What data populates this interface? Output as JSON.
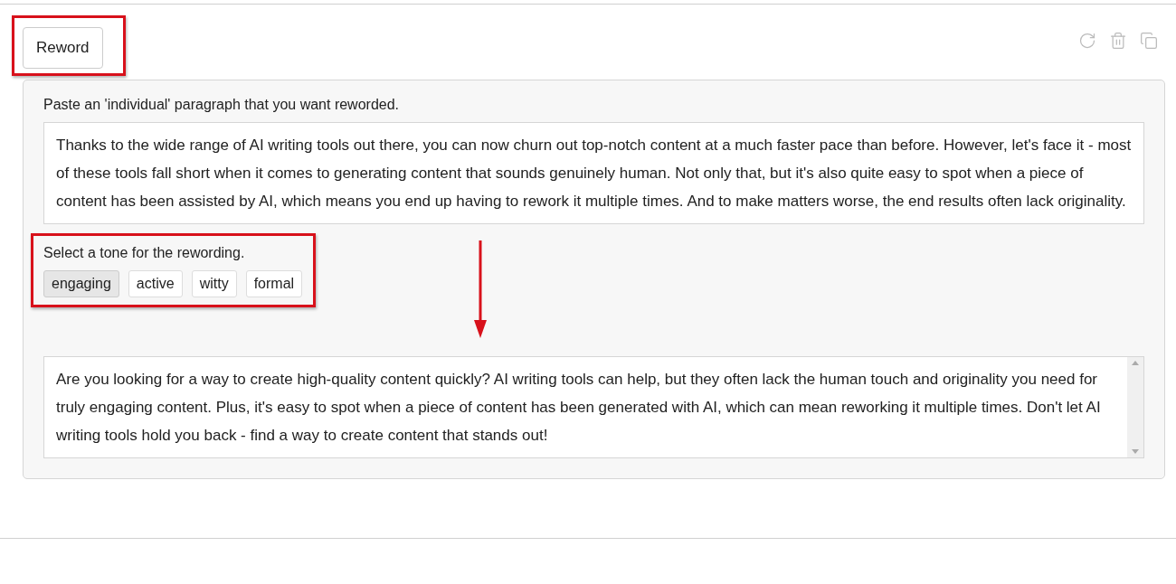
{
  "action_button": {
    "label": "Reword"
  },
  "input": {
    "label": "Paste an 'individual' paragraph that you want reworded.",
    "value": "Thanks to the wide range of AI writing tools out there, you can now churn out top-notch content at a much faster pace than before. However, let's face it - most of these tools fall short when it comes to generating content that sounds genuinely human. Not only that, but it's also quite easy to spot when a piece of content has been assisted by AI, which means you end up having to rework it multiple times. And to make matters worse, the end results often lack originality."
  },
  "tone": {
    "label": "Select a tone for the rewording.",
    "options": [
      {
        "label": "engaging",
        "selected": true
      },
      {
        "label": "active",
        "selected": false
      },
      {
        "label": "witty",
        "selected": false
      },
      {
        "label": "formal",
        "selected": false
      }
    ]
  },
  "output": {
    "value": "Are you looking for a way to create high-quality content quickly? AI writing tools can help, but they often lack the human touch and originality you need for truly engaging content. Plus, it's easy to spot when a piece of content has been generated with AI, which can mean reworking it multiple times. Don't let AI writing tools hold you back - find a way to create content that stands out!"
  }
}
